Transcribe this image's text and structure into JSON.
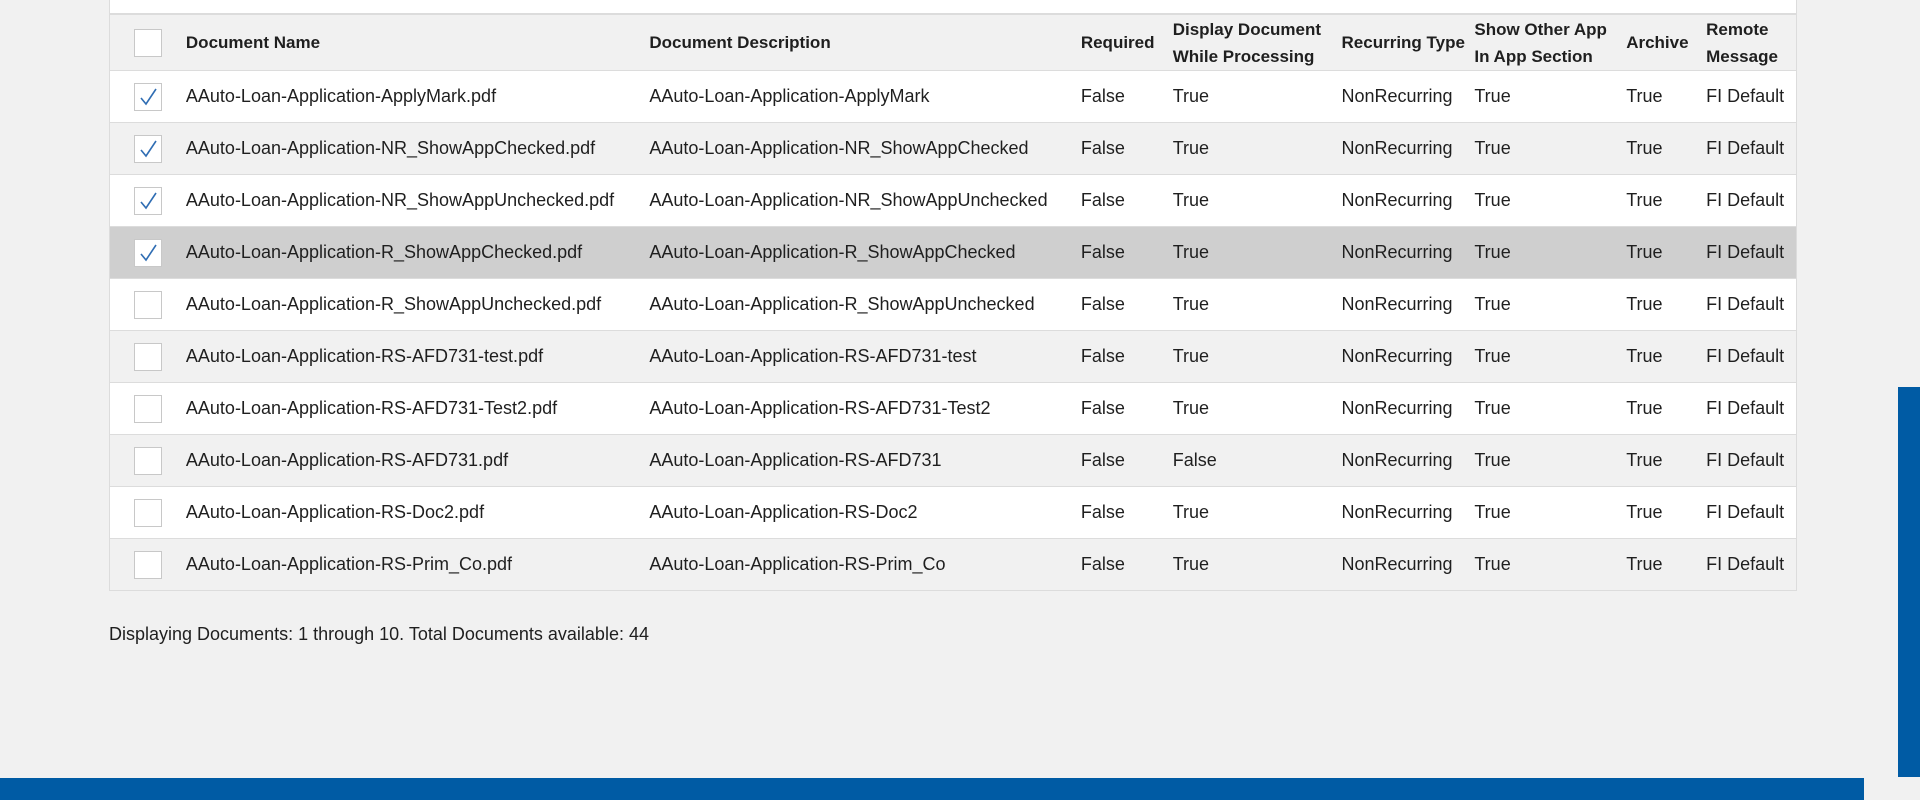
{
  "columns": {
    "name": "Document Name",
    "description": "Document Description",
    "required": "Required",
    "display": "Display Document While Processing",
    "recurring": "Recurring Type",
    "show_other": "Show Other App In App Section",
    "archive": "Archive",
    "remote": "Remote Message"
  },
  "rows": [
    {
      "checked": true,
      "selected": false,
      "name": "AAuto-Loan-Application-ApplyMark.pdf",
      "description": "AAuto-Loan-Application-ApplyMark",
      "required": "False",
      "display": "True",
      "recurring": "NonRecurring",
      "show_other": "True",
      "archive": "True",
      "remote": "FI Default"
    },
    {
      "checked": true,
      "selected": false,
      "name": "AAuto-Loan-Application-NR_ShowAppChecked.pdf",
      "description": "AAuto-Loan-Application-NR_ShowAppChecked",
      "required": "False",
      "display": "True",
      "recurring": "NonRecurring",
      "show_other": "True",
      "archive": "True",
      "remote": "FI Default"
    },
    {
      "checked": true,
      "selected": false,
      "name": "AAuto-Loan-Application-NR_ShowAppUnchecked.pdf",
      "description": "AAuto-Loan-Application-NR_ShowAppUnchecked",
      "required": "False",
      "display": "True",
      "recurring": "NonRecurring",
      "show_other": "True",
      "archive": "True",
      "remote": "FI Default"
    },
    {
      "checked": true,
      "selected": true,
      "name": "AAuto-Loan-Application-R_ShowAppChecked.pdf",
      "description": "AAuto-Loan-Application-R_ShowAppChecked",
      "required": "False",
      "display": "True",
      "recurring": "NonRecurring",
      "show_other": "True",
      "archive": "True",
      "remote": "FI Default"
    },
    {
      "checked": false,
      "selected": false,
      "name": "AAuto-Loan-Application-R_ShowAppUnchecked.pdf",
      "description": "AAuto-Loan-Application-R_ShowAppUnchecked",
      "required": "False",
      "display": "True",
      "recurring": "NonRecurring",
      "show_other": "True",
      "archive": "True",
      "remote": "FI Default"
    },
    {
      "checked": false,
      "selected": false,
      "name": "AAuto-Loan-Application-RS-AFD731-test.pdf",
      "description": "AAuto-Loan-Application-RS-AFD731-test",
      "required": "False",
      "display": "True",
      "recurring": "NonRecurring",
      "show_other": "True",
      "archive": "True",
      "remote": "FI Default"
    },
    {
      "checked": false,
      "selected": false,
      "name": "AAuto-Loan-Application-RS-AFD731-Test2.pdf",
      "description": "AAuto-Loan-Application-RS-AFD731-Test2",
      "required": "False",
      "display": "True",
      "recurring": "NonRecurring",
      "show_other": "True",
      "archive": "True",
      "remote": "FI Default"
    },
    {
      "checked": false,
      "selected": false,
      "name": "AAuto-Loan-Application-RS-AFD731.pdf",
      "description": "AAuto-Loan-Application-RS-AFD731",
      "required": "False",
      "display": "False",
      "recurring": "NonRecurring",
      "show_other": "True",
      "archive": "True",
      "remote": "FI Default"
    },
    {
      "checked": false,
      "selected": false,
      "name": "AAuto-Loan-Application-RS-Doc2.pdf",
      "description": "AAuto-Loan-Application-RS-Doc2",
      "required": "False",
      "display": "True",
      "recurring": "NonRecurring",
      "show_other": "True",
      "archive": "True",
      "remote": "FI Default"
    },
    {
      "checked": false,
      "selected": false,
      "name": "AAuto-Loan-Application-RS-Prim_Co.pdf",
      "description": "AAuto-Loan-Application-RS-Prim_Co",
      "required": "False",
      "display": "True",
      "recurring": "NonRecurring",
      "show_other": "True",
      "archive": "True",
      "remote": "FI Default"
    }
  ],
  "footer": {
    "status": "Displaying Documents: 1 through 10. Total Documents available: 44"
  },
  "colors": {
    "accent": "#005ba4",
    "check": "#2f6db3",
    "selected_row": "#cfcfcf"
  },
  "icons": {
    "check": "checkmark-icon"
  }
}
